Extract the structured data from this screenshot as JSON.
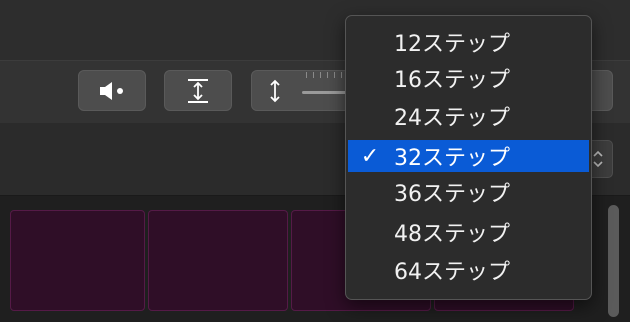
{
  "colors": {
    "accent": "#0a5bd6",
    "pad_fill": "#2f0e27",
    "pad_border": "#551a47",
    "menu_bg": "#2c2c2c"
  },
  "toolbar": {
    "buttons": [
      {
        "name": "mute",
        "icon": "speaker-mute-icon"
      },
      {
        "name": "fit",
        "icon": "fit-vertical-icon"
      },
      {
        "name": "vertical-zoom",
        "icon": "vertical-zoom-icon"
      }
    ]
  },
  "step_menu": {
    "selected_index": 3,
    "items": [
      {
        "label": "12ステップ",
        "checked": false
      },
      {
        "label": "16ステップ",
        "checked": false
      },
      {
        "label": "24ステップ",
        "checked": false
      },
      {
        "label": "32ステップ",
        "checked": true
      },
      {
        "label": "36ステップ",
        "checked": false
      },
      {
        "label": "48ステップ",
        "checked": false
      },
      {
        "label": "64ステップ",
        "checked": false
      }
    ],
    "check_glyph": "✓"
  }
}
